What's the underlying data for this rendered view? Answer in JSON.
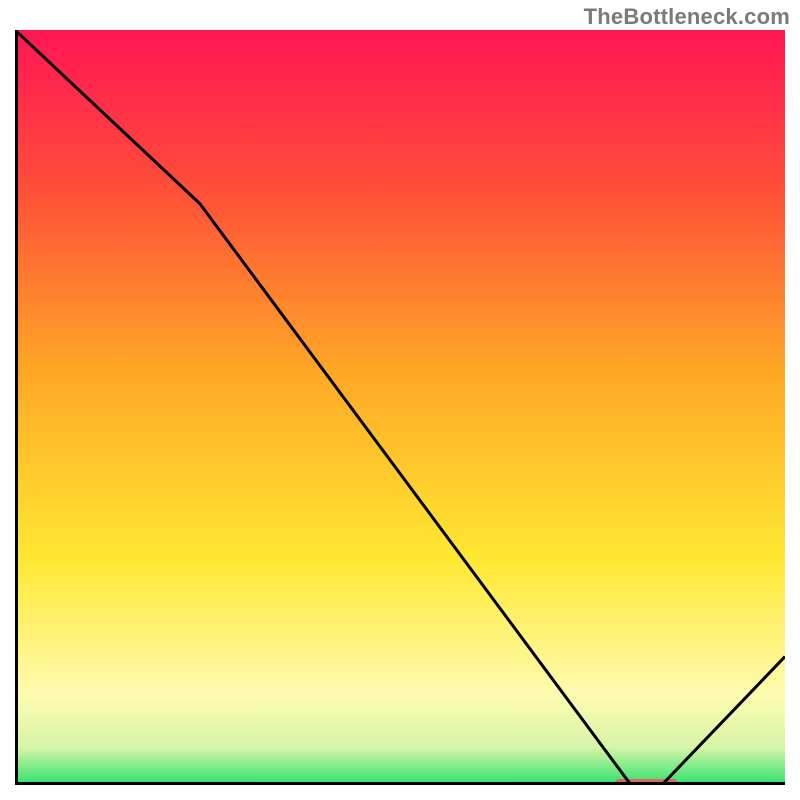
{
  "watermark": "TheBottleneck.com",
  "chart_data": {
    "type": "line",
    "title": "",
    "xlabel": "",
    "ylabel": "",
    "xlim": [
      0,
      100
    ],
    "ylim": [
      0,
      100
    ],
    "grid": false,
    "series": [
      {
        "name": "curve",
        "x": [
          0,
          24,
          80,
          84,
          100
        ],
        "values": [
          100,
          77,
          0,
          0,
          17
        ]
      }
    ],
    "marker": {
      "name": "highlight-segment",
      "x_start": 78,
      "x_end": 86,
      "y": 0,
      "color": "#d96a5e"
    },
    "background_gradient": {
      "stops": [
        {
          "offset": 0.0,
          "color": "#ff1655"
        },
        {
          "offset": 0.2,
          "color": "#ff4b3a"
        },
        {
          "offset": 0.45,
          "color": "#ffa726"
        },
        {
          "offset": 0.7,
          "color": "#ffe833"
        },
        {
          "offset": 0.88,
          "color": "#fffbb0"
        },
        {
          "offset": 0.95,
          "color": "#d7f5a8"
        },
        {
          "offset": 1.0,
          "color": "#2fe26b"
        }
      ]
    },
    "frame_color": "#000000"
  }
}
